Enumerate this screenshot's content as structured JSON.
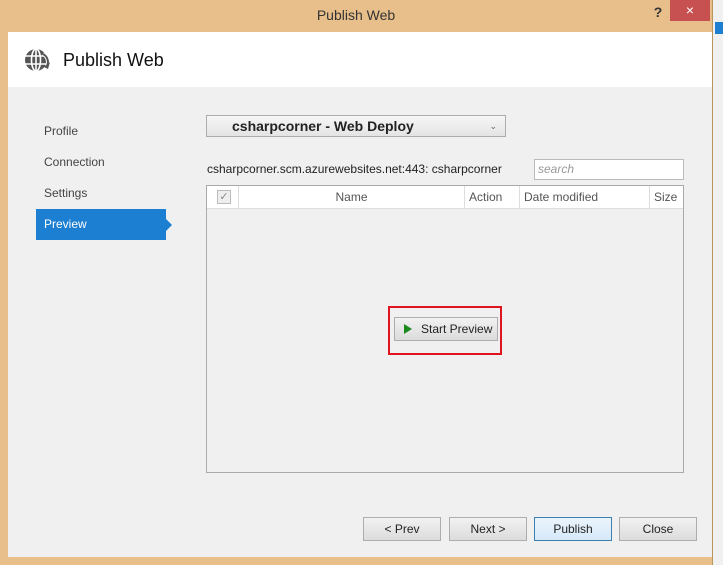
{
  "window": {
    "title": "Publish Web",
    "help": "?",
    "close": "×"
  },
  "header": {
    "title": "Publish Web"
  },
  "nav": {
    "items": [
      {
        "label": "Profile"
      },
      {
        "label": "Connection"
      },
      {
        "label": "Settings"
      },
      {
        "label": "Preview"
      }
    ],
    "active": "Preview"
  },
  "profile": {
    "selected": "csharpcorner - Web Deploy"
  },
  "server": "csharpcorner.scm.azurewebsites.net:443: csharpcorner",
  "search": {
    "placeholder": "search"
  },
  "grid": {
    "columns": [
      "Name",
      "Action",
      "Date modified",
      "Size"
    ]
  },
  "start_preview": "Start Preview",
  "buttons": {
    "prev": "< Prev",
    "next": "Next >",
    "publish": "Publish",
    "close": "Close"
  },
  "colors": {
    "accent": "#1c7fd1",
    "highlight": "#e0141e"
  }
}
